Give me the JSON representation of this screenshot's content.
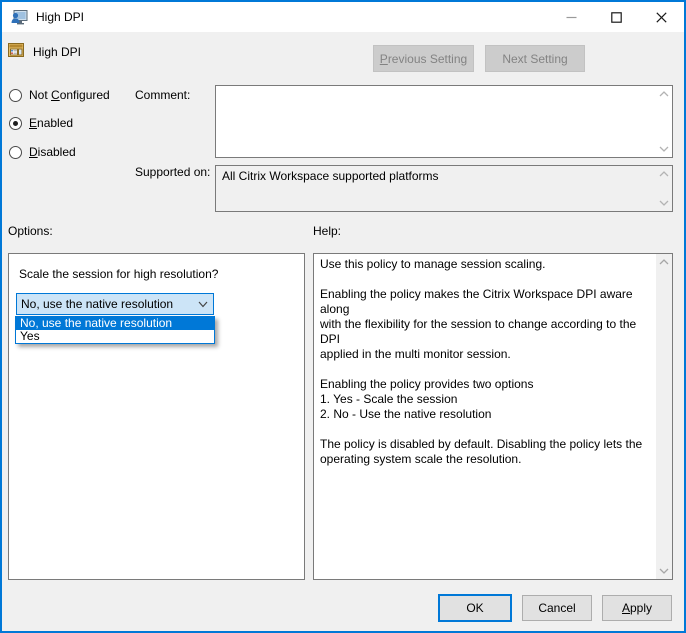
{
  "colors": {
    "accent": "#0078d7",
    "titlebar_bg": "#ffffff",
    "body_bg": "#f0f0f0",
    "combobox_fill": "#cce4f7",
    "dropdown_highlight": "#0078d7",
    "disabled_button_bg": "#cccccc",
    "disabled_button_text": "#838383",
    "button_bg": "#e1e1e1",
    "button_border": "#adadad",
    "box_border": "#7a7a7a"
  },
  "icons": {
    "app_icon": "monitor-user-icon",
    "policy_icon": "policy-document-icon",
    "minimize": "minimize-icon",
    "maximize": "maximize-icon",
    "close": "close-icon",
    "combobox_chevron": "chevron-down-icon",
    "scroll_up": "chevron-up-icon",
    "scroll_down": "chevron-down-icon"
  },
  "titlebar": {
    "title": "High DPI"
  },
  "header": {
    "policy_name": "High DPI",
    "previous_button": {
      "pre": "",
      "u": "P",
      "post": "revious Setting"
    },
    "next_button": "Next Setting"
  },
  "radios": {
    "not_configured": {
      "pre": "Not ",
      "u": "C",
      "post": "onfigured",
      "selected": false
    },
    "enabled": {
      "pre": "",
      "u": "E",
      "post": "nabled",
      "selected": true
    },
    "disabled": {
      "pre": "",
      "u": "D",
      "post": "isabled",
      "selected": false
    }
  },
  "comment": {
    "label": "Comment:",
    "value": ""
  },
  "supported_on": {
    "label": "Supported on:",
    "value": "All Citrix Workspace supported platforms"
  },
  "options": {
    "label": "Options:",
    "question": "Scale the session for high resolution?",
    "combobox_value": "No, use the native resolution",
    "dropdown_items": [
      {
        "label": "No, use the native resolution",
        "highlighted": true
      },
      {
        "label": "Yes",
        "highlighted": false
      }
    ]
  },
  "help": {
    "label": "Help:",
    "lines": [
      "Use this policy to manage session scaling.",
      "",
      "Enabling the policy makes the Citrix Workspace DPI aware along",
      "with the flexibility for the session to change according to the DPI",
      "applied in the multi monitor session.",
      "",
      "Enabling the policy provides two options",
      "1. Yes - Scale the session",
      "2. No - Use the native resolution",
      "",
      "The policy is disabled by default. Disabling the policy lets the",
      "operating system scale the resolution."
    ]
  },
  "footer": {
    "ok": "OK",
    "cancel": "Cancel",
    "apply": {
      "pre": "",
      "u": "A",
      "post": "pply"
    }
  }
}
